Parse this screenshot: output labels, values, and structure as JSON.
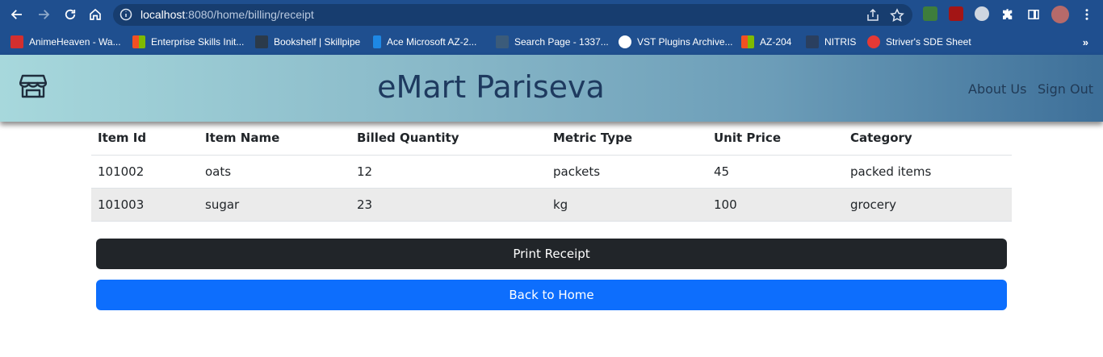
{
  "browser": {
    "url_host": "localhost",
    "url_path": ":8080/home/billing/receipt",
    "bookmarks": [
      {
        "label": "AnimeHeaven - Wa...",
        "color": "#d32f2f"
      },
      {
        "label": "Enterprise Skills Init...",
        "color": "#f25022"
      },
      {
        "label": "Bookshelf | Skillpipe",
        "color": "#2b3a4a"
      },
      {
        "label": "Ace Microsoft AZ-2...",
        "color": "#1e88e5"
      },
      {
        "label": "Search Page - 1337...",
        "color": "#3b5b7a"
      },
      {
        "label": "VST Plugins Archive...",
        "color": "#ffffff"
      },
      {
        "label": "AZ-204",
        "color": "#f25022"
      },
      {
        "label": "NITRIS",
        "color": "#2a3f5f"
      },
      {
        "label": "Striver's SDE Sheet",
        "color": "#e53935"
      }
    ],
    "more": "»"
  },
  "header": {
    "brand": "eMart Pariseva",
    "about": "About Us",
    "signout": "Sign Out"
  },
  "table": {
    "headers": [
      "Item Id",
      "Item Name",
      "Billed Quantity",
      "Metric Type",
      "Unit Price",
      "Category"
    ],
    "rows": [
      [
        "101002",
        "oats",
        "12",
        "packets",
        "45",
        "packed items"
      ],
      [
        "101003",
        "sugar",
        "23",
        "kg",
        "100",
        "grocery"
      ]
    ]
  },
  "actions": {
    "print": "Print Receipt",
    "back": "Back to Home"
  }
}
